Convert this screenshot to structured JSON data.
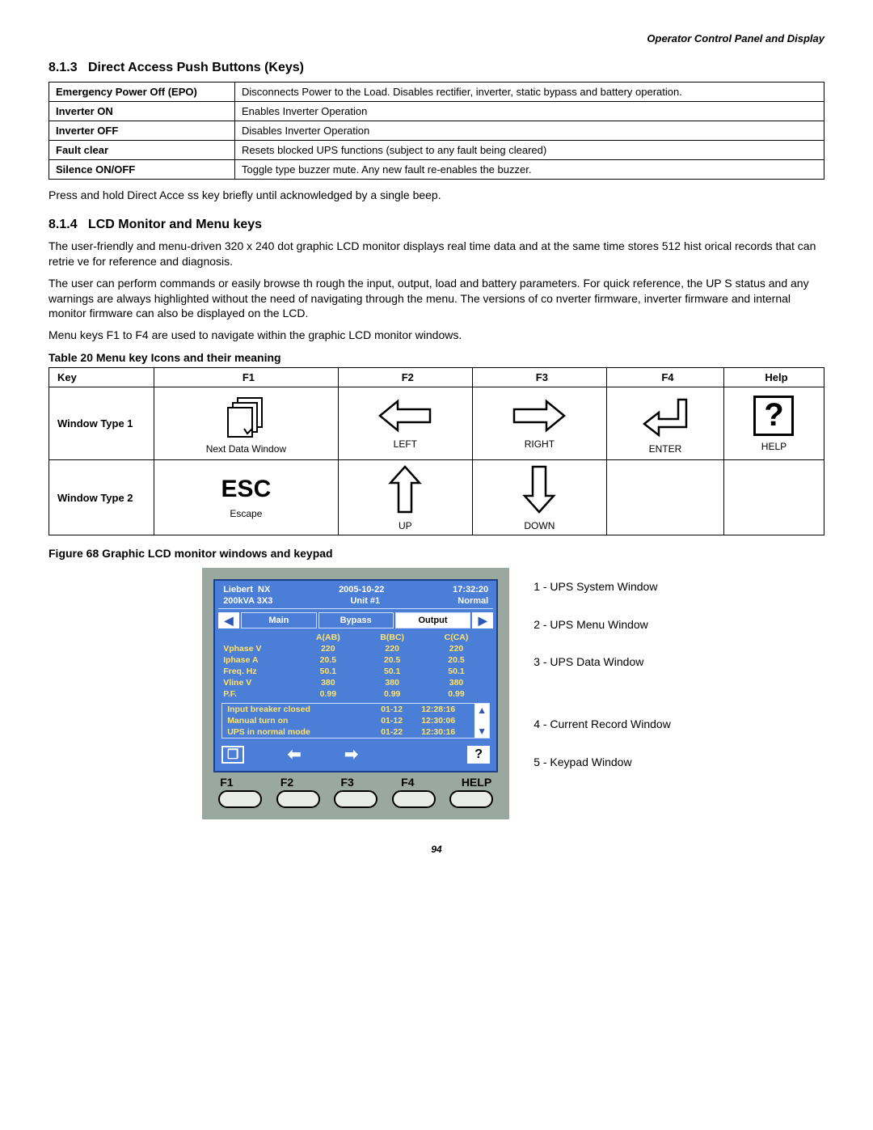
{
  "header": {
    "section_title": "Operator Control Panel and Display"
  },
  "s813": {
    "num": "8.1.3",
    "title": "Direct Access Push Buttons (Keys)",
    "rows": [
      {
        "k": "Emergency Power Off (EPO)",
        "v": "Disconnects Power to the Load. Disables rectifier, inverter, static bypass and battery operation."
      },
      {
        "k": "Inverter ON",
        "v": "Enables Inverter Operation"
      },
      {
        "k": "Inverter OFF",
        "v": "Disables Inverter Operation"
      },
      {
        "k": "Fault clear",
        "v": "Resets blocked UPS functions (subject to any fault being cleared)"
      },
      {
        "k": "Silence ON/OFF",
        "v": "Toggle type buzzer mute. Any new fault re-enables the buzzer."
      }
    ],
    "note": "Press and hold Direct Acce    ss key briefly until acknowledged by a single beep."
  },
  "s814": {
    "num": "8.1.4",
    "title": "LCD Monitor and Menu keys",
    "p1": "The user-friendly and menu-driven 320 x 240 dot graphic LCD monitor displays real time data and at the same time stores 512 hist  orical records that can retrie   ve for reference and diagnosis.",
    "p2": "The user can perform commands or easily browse th  rough the input, output,     load and battery parameters. For quick reference, the UP  S status and any warnings are always highlighted without the need of navigating through the menu. The versions of co   nverter firmware, inverter firmware and internal monitor firmware can also    be displayed on the LCD.",
    "p3": "Menu keys F1 to F4 are used to navigate   within the graphic    LCD monitor windows."
  },
  "table20": {
    "caption": "Table 20     Menu key Icons and their meaning",
    "headers": [
      "Key",
      "F1",
      "F2",
      "F3",
      "F4",
      "Help"
    ],
    "row1_label": "Window Type 1",
    "row1": {
      "f1": "Next Data Window",
      "f2": "LEFT",
      "f3": "RIGHT",
      "f4": "ENTER",
      "help": "HELP"
    },
    "row2_label": "Window Type 2",
    "row2": {
      "f1": "Escape",
      "f1_big": "ESC",
      "f2": "UP",
      "f3": "DOWN",
      "f4": "",
      "help": ""
    },
    "help_glyph": "?"
  },
  "fig68": {
    "caption": "Figure 68  Graphic LCD monitor windows and keypad",
    "sys": {
      "brand": "Liebert",
      "model": "NX",
      "date": "2005-10-22",
      "time": "17:32:20",
      "rating": "200kVA 3X3",
      "unit": "Unit #1",
      "status": "Normal"
    },
    "tabs": {
      "left": "Main",
      "mid": "Bypass",
      "right": "Output"
    },
    "cols": [
      "A(AB)",
      "B(BC)",
      "C(CA)"
    ],
    "rows": [
      {
        "l": "Vphase V",
        "a": "220",
        "b": "220",
        "c": "220"
      },
      {
        "l": "Iphase A",
        "a": "20.5",
        "b": "20.5",
        "c": "20.5"
      },
      {
        "l": "Freq. Hz",
        "a": "50.1",
        "b": "50.1",
        "c": "50.1"
      },
      {
        "l": "Vline V",
        "a": "380",
        "b": "380",
        "c": "380"
      },
      {
        "l": "P.F.",
        "a": "0.99",
        "b": "0.99",
        "c": "0.99"
      }
    ],
    "events": [
      {
        "t": "Input breaker closed",
        "d": "01-12",
        "tm": "12:28:16"
      },
      {
        "t": "Manual turn on",
        "d": "01-12",
        "tm": "12:30:06"
      },
      {
        "t": "UPS in normal mode",
        "d": "01-22",
        "tm": "12:30:16"
      }
    ],
    "fkeys": [
      "F1",
      "F2",
      "F3",
      "F4",
      "HELP"
    ],
    "callouts": [
      "1 - UPS System Window",
      "2 - UPS Menu Window",
      "3 - UPS Data Window",
      "4 - Current Record Window",
      "5 - Keypad Window"
    ]
  },
  "page_number": "94"
}
